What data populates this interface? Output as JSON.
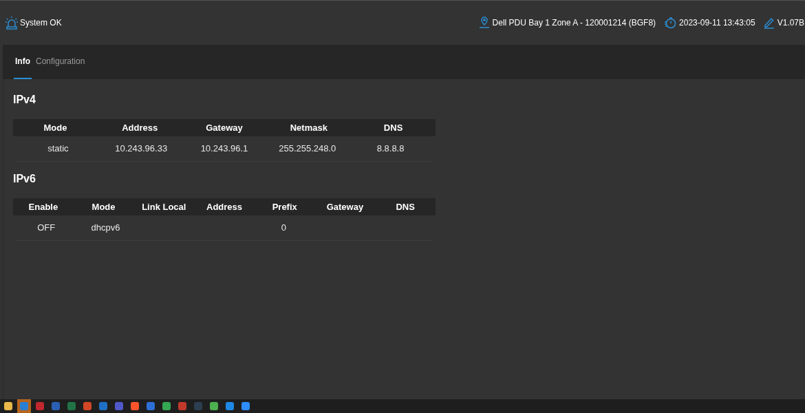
{
  "header": {
    "status": "System OK",
    "location": "Dell PDU Bay 1 Zone A - 120001214 (BGF8)",
    "datetime": "2023-09-11 13:43:05",
    "version": "V1.07B"
  },
  "tabs": [
    {
      "label": "Info",
      "selected": true
    },
    {
      "label": "Configuration",
      "selected": false
    }
  ],
  "sections": [
    {
      "title": "IPv4",
      "columns": [
        "Mode",
        "Address",
        "Gateway",
        "Netmask",
        "DNS"
      ],
      "rows": [
        [
          "static",
          "10.243.96.33",
          "10.243.96.1",
          "255.255.248.0",
          "8.8.8.8"
        ]
      ]
    },
    {
      "title": "IPv6",
      "columns": [
        "Enable",
        "Mode",
        "Link Local",
        "Address",
        "Prefix",
        "Gateway",
        "DNS"
      ],
      "rows": [
        [
          "OFF",
          "dhcpv6",
          "",
          "",
          "0",
          "",
          ""
        ]
      ]
    }
  ],
  "taskbar": [
    {
      "color": "#e8b84a",
      "selected": false
    },
    {
      "color": "#2a7fd4",
      "selected": true
    },
    {
      "color": "#c0282d",
      "selected": false
    },
    {
      "color": "#2b5fb4",
      "selected": false
    },
    {
      "color": "#217346",
      "selected": false
    },
    {
      "color": "#d24726",
      "selected": false
    },
    {
      "color": "#1f6fc5",
      "selected": false
    },
    {
      "color": "#5059c9",
      "selected": false
    },
    {
      "color": "#fb542b",
      "selected": false
    },
    {
      "color": "#2d6fd6",
      "selected": false
    },
    {
      "color": "#34a853",
      "selected": false
    },
    {
      "color": "#c0392b",
      "selected": false
    },
    {
      "color": "#2c3e50",
      "selected": false
    },
    {
      "color": "#4caf50",
      "selected": false
    },
    {
      "color": "#1e88e5",
      "selected": false
    },
    {
      "color": "#2d8cff",
      "selected": false
    }
  ]
}
